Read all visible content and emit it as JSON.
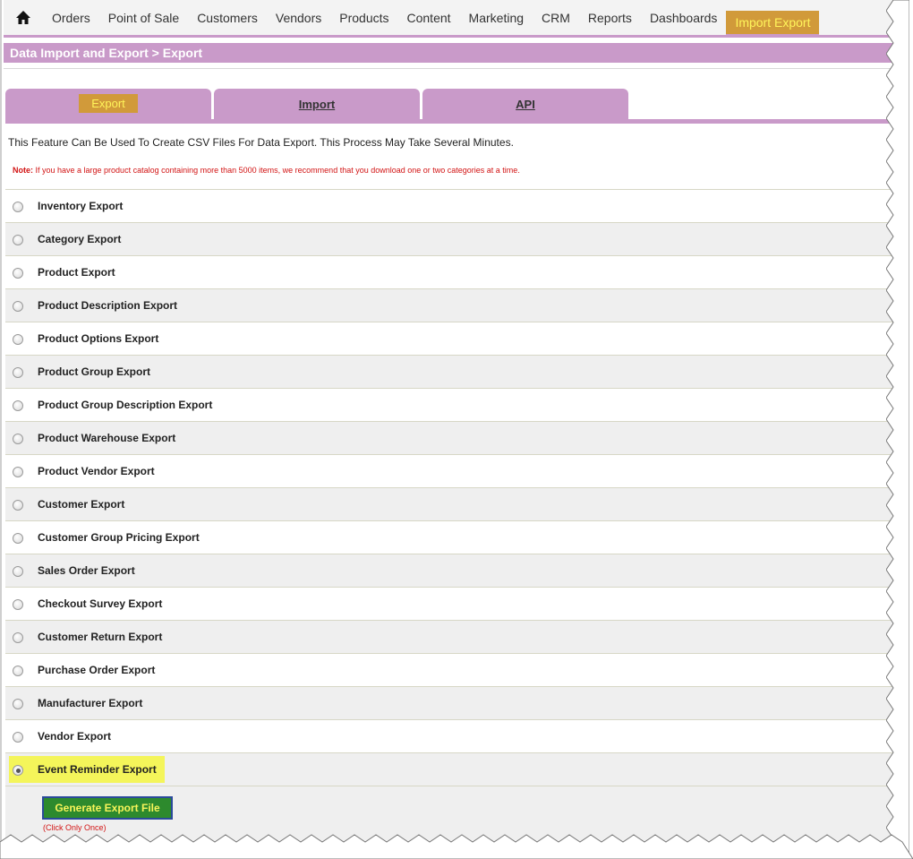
{
  "nav": {
    "items": [
      "Orders",
      "Point of Sale",
      "Customers",
      "Vendors",
      "Products",
      "Content",
      "Marketing",
      "CRM",
      "Reports",
      "Dashboards"
    ],
    "active": "Import Export"
  },
  "breadcrumb": "Data Import and Export > Export",
  "tabs": [
    {
      "label": "Export",
      "active": true
    },
    {
      "label": "Import",
      "active": false
    },
    {
      "label": "API",
      "active": false
    }
  ],
  "intro": "This Feature Can Be Used To Create CSV Files For Data Export. This Process May Take Several Minutes.",
  "note": {
    "label": "Note:",
    "text": " If you have a large product catalog containing more than 5000 items, we recommend that you download one or two categories at a time."
  },
  "exports": [
    {
      "label": "Inventory Export",
      "checked": false
    },
    {
      "label": "Category Export",
      "checked": false
    },
    {
      "label": "Product Export",
      "checked": false
    },
    {
      "label": "Product Description Export",
      "checked": false
    },
    {
      "label": "Product Options Export",
      "checked": false
    },
    {
      "label": "Product Group Export",
      "checked": false
    },
    {
      "label": "Product Group Description Export",
      "checked": false
    },
    {
      "label": "Product Warehouse Export",
      "checked": false
    },
    {
      "label": "Product Vendor Export",
      "checked": false
    },
    {
      "label": "Customer Export",
      "checked": false
    },
    {
      "label": "Customer Group Pricing Export",
      "checked": false
    },
    {
      "label": "Sales Order Export",
      "checked": false
    },
    {
      "label": "Checkout Survey Export",
      "checked": false
    },
    {
      "label": "Customer Return Export",
      "checked": false
    },
    {
      "label": "Purchase Order Export",
      "checked": false
    },
    {
      "label": "Manufacturer Export",
      "checked": false
    },
    {
      "label": "Vendor Export",
      "checked": false
    },
    {
      "label": "Event Reminder Export",
      "checked": true
    }
  ],
  "generate_button": "Generate Export File",
  "click_once": "(Click Only Once)",
  "colors": {
    "accent_purple": "#c99ac9",
    "active_tab_bg": "#d19a3a",
    "active_tab_text": "#fff45a",
    "note_red": "#d21414",
    "button_green": "#2d8a2d",
    "highlight_yellow": "#f4f55a"
  },
  "icons": {
    "home": "home-icon"
  }
}
